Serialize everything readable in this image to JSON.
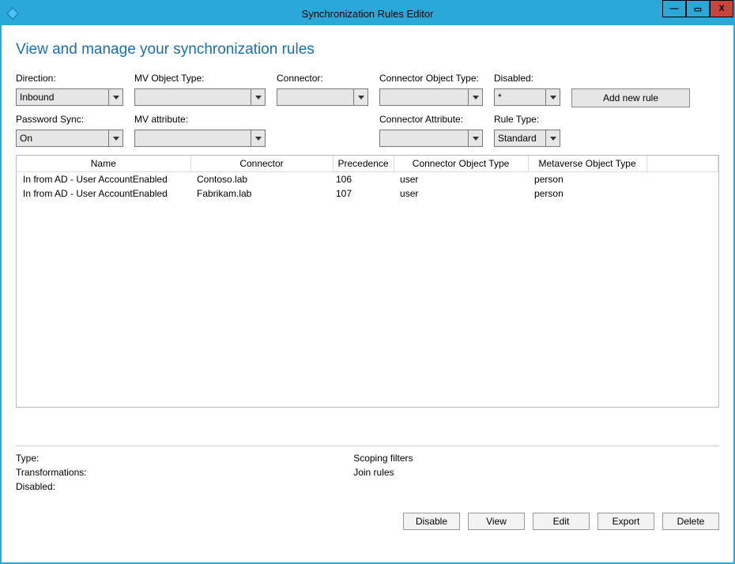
{
  "window": {
    "title": "Synchronization Rules Editor"
  },
  "page": {
    "heading": "View and manage your synchronization rules"
  },
  "filters": {
    "direction": {
      "label": "Direction:",
      "value": "Inbound"
    },
    "mv_object": {
      "label": "MV Object Type:",
      "value": ""
    },
    "connector": {
      "label": "Connector:",
      "value": ""
    },
    "conn_obj": {
      "label": "Connector Object Type:",
      "value": ""
    },
    "disabled": {
      "label": "Disabled:",
      "value": "*"
    },
    "pwd_sync": {
      "label": "Password Sync:",
      "value": "On"
    },
    "mv_attr": {
      "label": "MV attribute:",
      "value": ""
    },
    "conn_attr": {
      "label": "Connector Attribute:",
      "value": ""
    },
    "rule_type": {
      "label": "Rule Type:",
      "value": "Standard"
    }
  },
  "actions": {
    "add": "Add new rule",
    "disable": "Disable",
    "view": "View",
    "edit": "Edit",
    "export": "Export",
    "delete": "Delete"
  },
  "table": {
    "columns": {
      "name": "Name",
      "connector": "Connector",
      "precedence": "Precedence",
      "conn_obj": "Connector Object Type",
      "mv_obj": "Metaverse Object Type"
    },
    "rows": [
      {
        "name": "In from AD - User AccountEnabled",
        "connector": "Contoso.lab",
        "precedence": "106",
        "conn_obj": "user",
        "mv_obj": "person"
      },
      {
        "name": "In from AD - User AccountEnabled",
        "connector": "Fabrikam.lab",
        "precedence": "107",
        "conn_obj": "user",
        "mv_obj": "person"
      }
    ]
  },
  "details": {
    "type_label": "Type:",
    "type_value": "",
    "transformations_label": "Transformations:",
    "transformations_value": "",
    "disabled_label": "Disabled:",
    "disabled_value": "",
    "scoping_label": "Scoping filters",
    "scoping_value": "",
    "join_label": "Join rules",
    "join_value": ""
  }
}
